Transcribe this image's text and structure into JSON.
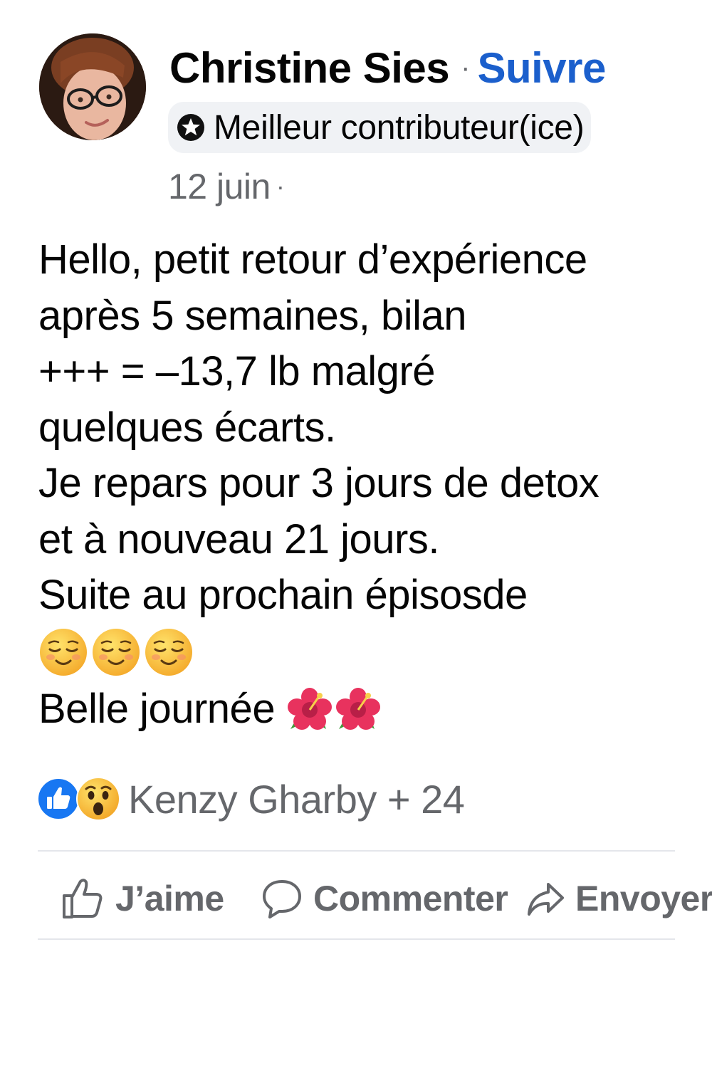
{
  "post": {
    "author": "Christine Sies",
    "separator": "·",
    "follow_label": "Suivre",
    "badge_label": "Meilleur contributeur(ice)",
    "date": "12 juin",
    "date_separator": "·",
    "audience_icon": "globe-icon",
    "body_lines": [
      "Hello, petit retour d’expérience",
      "après 5 semaines, bilan",
      "+++ = –13,7 lb malgré",
      "quelques écarts.",
      "Je repars pour 3 jours de detox",
      "et à nouveau 21 jours.",
      "Suite au prochain épisosde"
    ],
    "emoji_line": [
      "relieved-face-emoji",
      "relieved-face-emoji",
      "relieved-face-emoji"
    ],
    "closing_text": "Belle journée",
    "closing_emojis": [
      "hibiscus-emoji",
      "hibiscus-emoji"
    ]
  },
  "reactions": {
    "icons": [
      "like-reaction-icon",
      "wow-reaction-icon"
    ],
    "summary": "Kenzy Gharby + 24"
  },
  "actions": {
    "like_label": "J’aime",
    "comment_label": "Commenter",
    "share_label": "Envoyer"
  },
  "colors": {
    "link_blue": "#1b5fcc",
    "like_blue": "#1877f2",
    "secondary_text": "#65676b",
    "badge_bg": "#f0f2f5"
  }
}
